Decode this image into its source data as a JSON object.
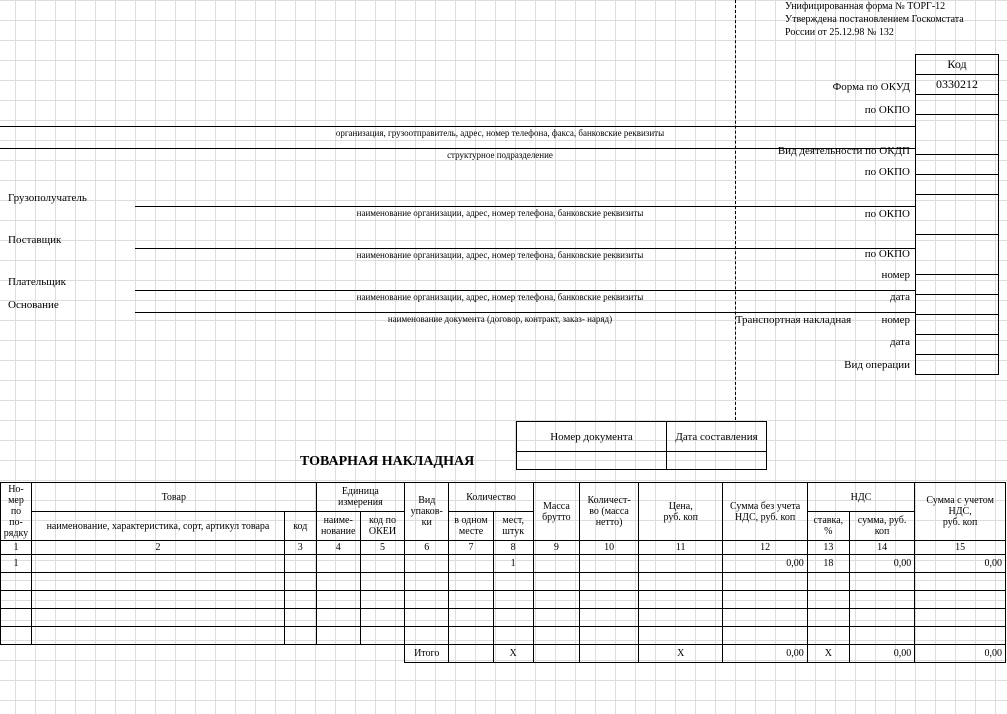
{
  "form_header": {
    "line1": "Унифицированная форма № ТОРГ-12",
    "line2": "Утверждена постановлением Госкомстата",
    "line3": "России от 25.12.98  № 132"
  },
  "code_table": {
    "header": "Код",
    "okud": "0330212"
  },
  "right_labels": {
    "forma_okud": "Форма по ОКУД",
    "po_okpo1": "по ОКПО",
    "vid_deyat": "Вид деятельности по ОКДП",
    "po_okpo2": "по ОКПО",
    "po_okpo3": "по ОКПО",
    "po_okpo4": "по ОКПО",
    "nomer1": "номер",
    "data1": "дата",
    "trans_nakl": "Транспортная накладная",
    "nomer2": "номер",
    "data2": "дата",
    "vid_oper": "Вид операции"
  },
  "left_labels": {
    "gruzopoluchatel": "Грузополучатель",
    "postavshik": "Поставщик",
    "platelshik": "Плательщик",
    "osnovanie": "Основание"
  },
  "captions": {
    "org_gruz": "организация, грузоотправитель, адрес, номер телефона, факса, банковские реквизиты",
    "struct": "структурное подразделение",
    "naim_org": "наименование организации, адрес, номер телефона, банковские реквизиты",
    "naim_doc": "наименование документа (договор, контракт, заказ- наряд)"
  },
  "title": "ТОВАРНАЯ НАКЛАДНАЯ",
  "doc_box": {
    "nomer": "Номер документа",
    "data": "Дата составления"
  },
  "table": {
    "headers": {
      "no": "Но-\nмер по по-\nрядку",
      "tovar": "Товар",
      "naim": "наименование, характеристика, сорт, артикул товара",
      "kod": "код",
      "ed_izm": "Единица измерения",
      "naim_ed": "наиме-\nнование",
      "kod_okei": "код по ОКЕИ",
      "vid_upak": "Вид упаков-\nки",
      "kolichestvo": "Количество",
      "v_odnom": "в одном месте",
      "mest": "мест, штук",
      "massa_brutto": "Масса брутто",
      "kolich_netto": "Количест-\nво (масса нетто)",
      "cena": "Цена,\nруб. коп",
      "summa_bez": "Сумма без учета НДС, руб. коп",
      "nds": "НДС",
      "stavka": "ставка, %",
      "summa_nds": "сумма, руб. коп",
      "summa_s": "Сумма с учетом НДС,\nруб. коп"
    },
    "nums": [
      "1",
      "2",
      "3",
      "4",
      "5",
      "6",
      "7",
      "8",
      "9",
      "10",
      "11",
      "12",
      "13",
      "14",
      "15"
    ],
    "row1": {
      "no": "1",
      "mest": "1",
      "summa_bez": "0,00",
      "stavka": "18",
      "summa_nds": "0,00",
      "summa_s": "0,00"
    },
    "total_label": "Итого",
    "totals": {
      "x": "X",
      "summa_bez": "0,00",
      "stavka": "X",
      "summa_nds": "0,00",
      "summa_s": "0,00"
    }
  }
}
